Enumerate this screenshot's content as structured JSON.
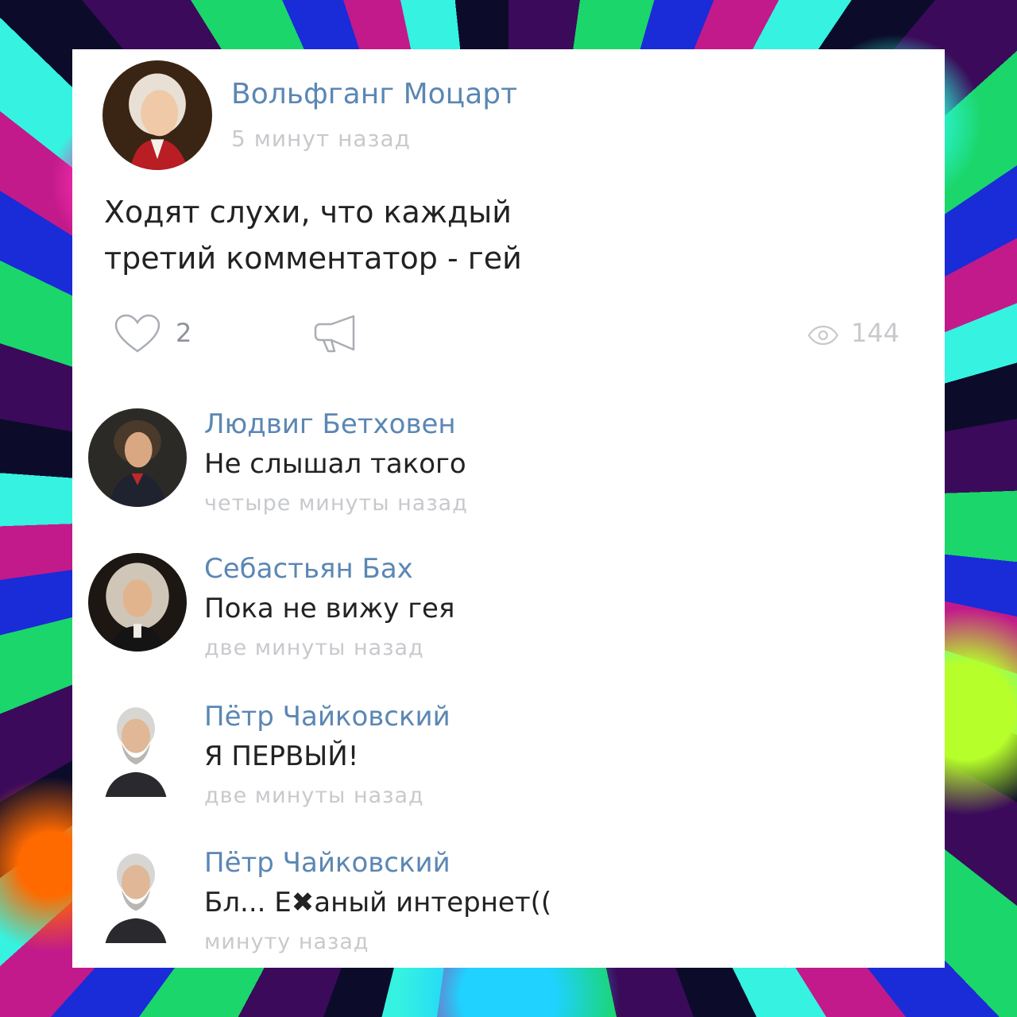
{
  "post": {
    "author": "Вольфганг Моцарт",
    "time": "5 минут назад",
    "text_lines": [
      "Ходят слухи, что каждый",
      "третий комментатор - гей"
    ],
    "likes": "2",
    "views": "144"
  },
  "comments": [
    {
      "author": "Людвиг Бетховен",
      "text": "Не слышал такого",
      "time": "четыре минуты назад"
    },
    {
      "author": "Себастьян Бах",
      "text": "Пока не вижу гея",
      "time": "две минуты назад"
    },
    {
      "author": "Пётр Чайковский",
      "text": "Я ПЕРВЫЙ!",
      "time": "две минуты назад"
    },
    {
      "author": "Пётр Чайковский",
      "text": "Бл... Е✖аный интернет((",
      "time": "минуту назад"
    }
  ],
  "icons": {
    "like": "heart-icon",
    "share": "megaphone-icon",
    "views": "eye-icon"
  },
  "colors": {
    "name": "#5b87b3",
    "meta": "#c7c9cc",
    "text": "#222222"
  }
}
